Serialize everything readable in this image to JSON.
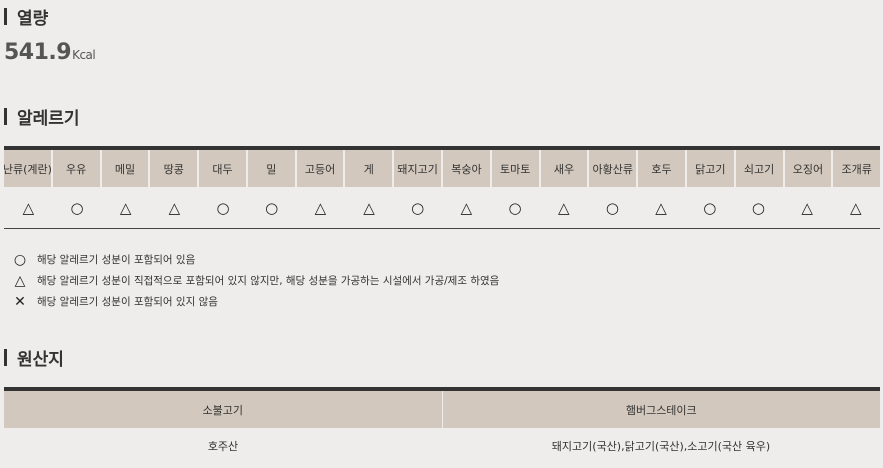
{
  "calories_section": {
    "title": "열량",
    "value": "541.9",
    "unit": "Kcal"
  },
  "allergy_section": {
    "title": "알레르기",
    "items": [
      {
        "name": "난류(계란)",
        "symbol": "△"
      },
      {
        "name": "우유",
        "symbol": "○"
      },
      {
        "name": "메밀",
        "symbol": "△"
      },
      {
        "name": "땅콩",
        "symbol": "△"
      },
      {
        "name": "대두",
        "symbol": "○"
      },
      {
        "name": "밀",
        "symbol": "○"
      },
      {
        "name": "고등어",
        "symbol": "△"
      },
      {
        "name": "게",
        "symbol": "△"
      },
      {
        "name": "돼지고기",
        "symbol": "○"
      },
      {
        "name": "복숭아",
        "symbol": "△"
      },
      {
        "name": "토마토",
        "symbol": "○"
      },
      {
        "name": "새우",
        "symbol": "△"
      },
      {
        "name": "아황산류",
        "symbol": "○"
      },
      {
        "name": "호두",
        "symbol": "△"
      },
      {
        "name": "닭고기",
        "symbol": "○"
      },
      {
        "name": "쇠고기",
        "symbol": "○"
      },
      {
        "name": "오징어",
        "symbol": "△"
      },
      {
        "name": "조개류",
        "symbol": "△"
      }
    ],
    "legend": [
      {
        "symbol": "○",
        "text": "해당 알레르기 성분이 포함되어 있음"
      },
      {
        "symbol": "△",
        "text": "해당 알레르기 성분이 직접적으로 포함되어 있지 않지만, 해당 성분을 가공하는 시설에서 가공/제조 하였음"
      },
      {
        "symbol": "✕",
        "text": "해당 알레르기 성분이 포함되어 있지 않음"
      }
    ]
  },
  "origin_section": {
    "title": "원산지",
    "headers": [
      "소불고기",
      "햄버그스테이크"
    ],
    "values": [
      "호주산",
      "돼지고기(국산),닭고기(국산),소고기(국산 육우)"
    ]
  }
}
